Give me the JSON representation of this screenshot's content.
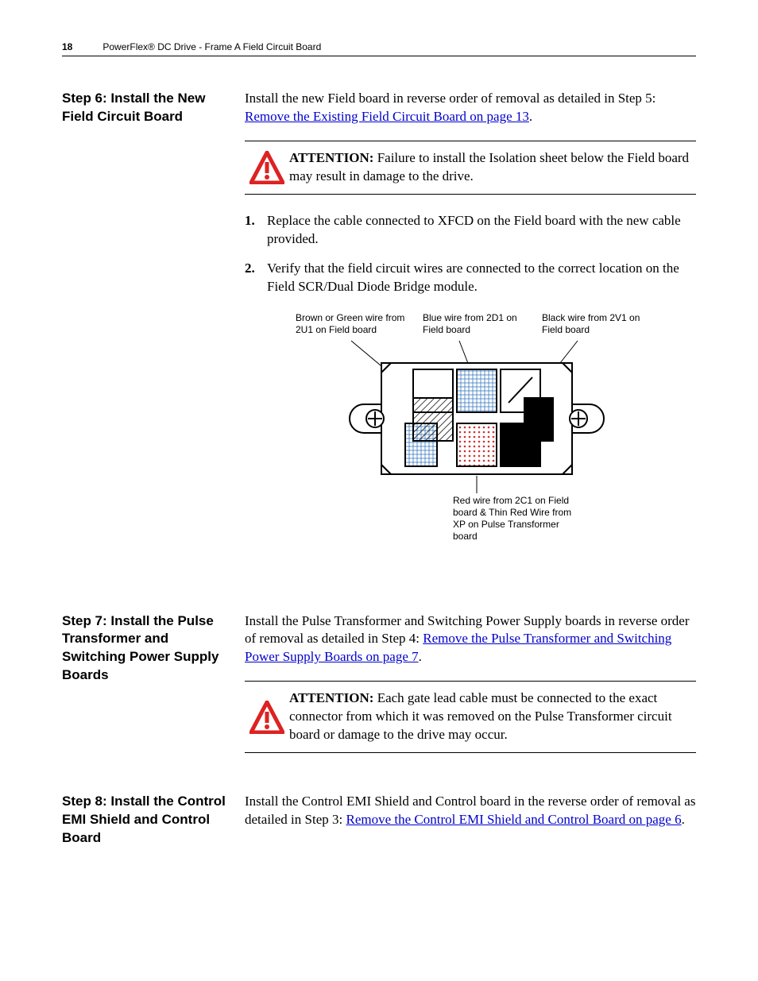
{
  "header": {
    "page_number": "18",
    "doc_title": "PowerFlex® DC Drive - Frame A Field Circuit Board"
  },
  "step6": {
    "heading": "Step 6:   Install the New Field Circuit Board",
    "intro_pre": "Install the new Field board in reverse order of removal as detailed in Step 5: ",
    "intro_link": "Remove the Existing Field Circuit Board on page 13",
    "intro_post": ".",
    "attention_label": "ATTENTION:",
    "attention_text": "  Failure to install the Isolation sheet below the Field board may result in damage to the drive.",
    "items": [
      "Replace the cable connected to XFCD on the Field board with the new cable provided.",
      "Verify that the field circuit wires are connected to the correct location on the Field SCR/Dual Diode Bridge module."
    ],
    "diagram": {
      "label_brown": "Brown or Green wire from 2U1 on Field board",
      "label_blue": "Blue wire from 2D1 on Field board",
      "label_black": "Black wire from 2V1 on Field board",
      "label_red": "Red wire from 2C1 on Field board & Thin Red Wire from XP on Pulse Transformer board"
    }
  },
  "step7": {
    "heading": "Step 7:   Install the Pulse Transformer and Switching Power Supply Boards",
    "intro_pre": "Install the Pulse Transformer and Switching Power Supply boards in reverse order of removal as detailed in Step 4: ",
    "intro_link": "Remove the Pulse Transformer and Switching Power Supply Boards on page 7",
    "intro_post": ".",
    "attention_label": "ATTENTION:",
    "attention_text": "  Each gate lead cable must be connected to the exact connector from which it was removed on the Pulse Transformer circuit board or damage to the drive may occur."
  },
  "step8": {
    "heading": "Step 8:   Install the Control EMI Shield and Control Board",
    "intro_pre": "Install the Control EMI Shield and Control board in the reverse order of removal as detailed in Step 3: ",
    "intro_link": "Remove the Control EMI Shield and Control Board on page 6",
    "intro_post": "."
  }
}
